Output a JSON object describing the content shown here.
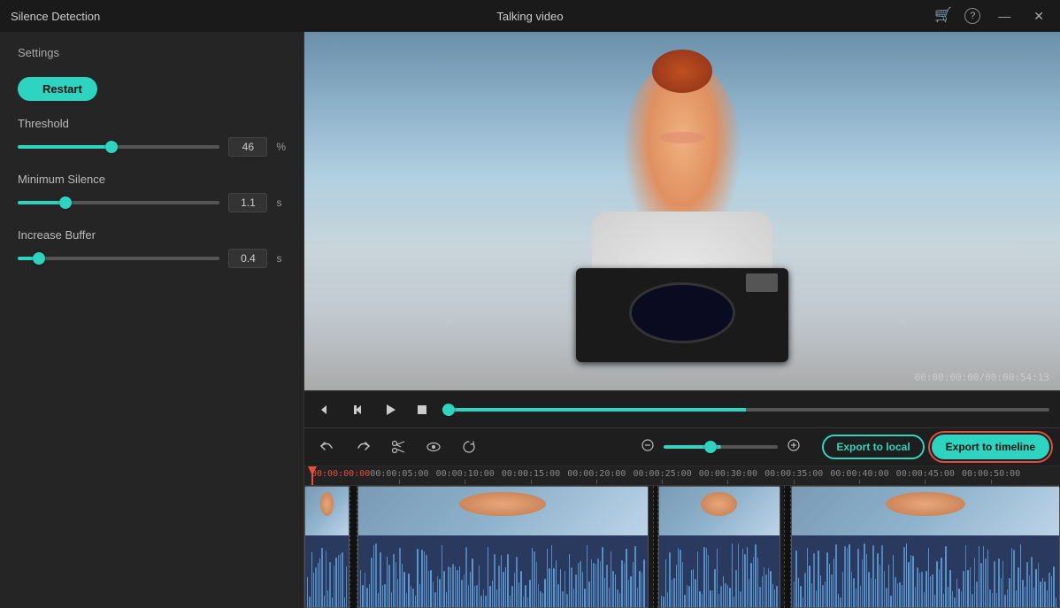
{
  "app": {
    "title": "Silence Detection",
    "window_title": "Talking video"
  },
  "titlebar": {
    "cart_icon": "🛒",
    "help_icon": "?",
    "minimize_icon": "—",
    "close_icon": "✕"
  },
  "left_panel": {
    "settings_label": "Settings",
    "restart_label": "Restart",
    "threshold": {
      "label": "Threshold",
      "value": "46",
      "unit": "%",
      "pct": "46"
    },
    "min_silence": {
      "label": "Minimum Silence",
      "value": "1.1",
      "unit": "s",
      "pct": "22"
    },
    "increase_buffer": {
      "label": "Increase Buffer",
      "value": "0.4",
      "unit": "s",
      "pct": "8"
    }
  },
  "playback": {
    "rewind_icon": "◀",
    "step_back_icon": "⏮",
    "play_icon": "▶",
    "stop_icon": "⏹",
    "timestamp": "00:00:00:00/00:00:54:13"
  },
  "timeline_toolbar": {
    "undo_icon": "↩",
    "redo_icon": "↪",
    "cut_icon": "✂",
    "view_icon": "👁",
    "history_icon": "⟲",
    "zoom_minus_icon": "⊖",
    "zoom_plus_icon": "⊕",
    "export_local_label": "Export to local",
    "export_timeline_label": "Export to timeline"
  },
  "timeline": {
    "ticks": [
      {
        "label": "00:00:00:00",
        "pct": 0
      },
      {
        "label": "00:00:05:00",
        "pct": 8.7
      },
      {
        "label": "00:00:10:00",
        "pct": 17.4
      },
      {
        "label": "00:00:15:00",
        "pct": 26.1
      },
      {
        "label": "00:00:20:00",
        "pct": 34.8
      },
      {
        "label": "00:00:25:00",
        "pct": 43.5
      },
      {
        "label": "00:00:30:00",
        "pct": 52.2
      },
      {
        "label": "00:00:35:00",
        "pct": 60.9
      },
      {
        "label": "00:00:40:00",
        "pct": 69.6
      },
      {
        "label": "00:00:45:00",
        "pct": 78.3
      },
      {
        "label": "00:00:50:00",
        "pct": 87.0
      }
    ],
    "clips": [
      {
        "left_pct": 0,
        "width_pct": 6.0
      },
      {
        "left_pct": 7.0,
        "width_pct": 38.5
      },
      {
        "left_pct": 46.8,
        "width_pct": 16.2
      },
      {
        "left_pct": 64.4,
        "width_pct": 35.6
      }
    ],
    "gaps": [
      {
        "left_pct": 6.0,
        "width_pct": 1.0
      },
      {
        "left_pct": 46.1,
        "width_pct": 0.7
      },
      {
        "left_pct": 63.5,
        "width_pct": 0.9
      }
    ]
  },
  "colors": {
    "accent": "#2dd4bf",
    "playhead": "#e74c3c",
    "export_outline": "#e74c3c"
  }
}
